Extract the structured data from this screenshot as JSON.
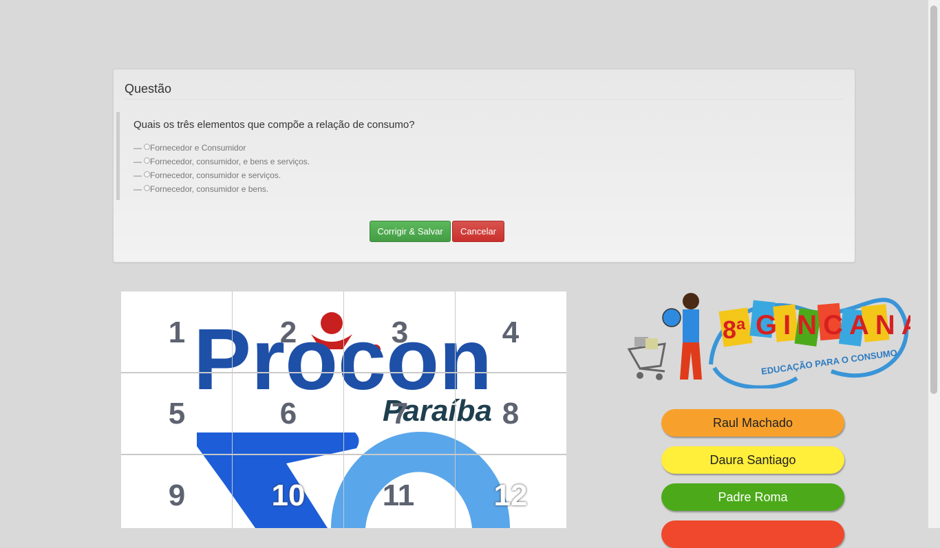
{
  "panel": {
    "title": "Questão",
    "question": "Quais os três elementos que compõe a relação de consumo?",
    "option_dash": "—",
    "options": [
      "Fornecedor e Consumidor",
      "Fornecedor, consumidor, e bens e serviços.",
      "Fornecedor, consumidor e serviços.",
      "Fornecedor, consumidor e bens."
    ],
    "save_label": "Corrigir & Salvar",
    "cancel_label": "Cancelar"
  },
  "puzzle": {
    "logo_text": "Procon",
    "logo_sub": "Paraíba",
    "numbers": [
      "1",
      "2",
      "3",
      "4",
      "5",
      "6",
      "7",
      "8",
      "9",
      "10",
      "11",
      "12"
    ]
  },
  "gincana": {
    "number": "8ª",
    "word": "GINCANA",
    "subtitle": "EDUCAÇÃO PARA O CONSUMO"
  },
  "teams": [
    {
      "name": "Raul Machado",
      "color": "#f7a12c",
      "text": "#222"
    },
    {
      "name": "Daura Santiago",
      "color": "#ffee3a",
      "text": "#222"
    },
    {
      "name": "Padre Roma",
      "color": "#4caa1a",
      "text": "#fff"
    },
    {
      "name": "",
      "color": "#f0482c",
      "text": "#fff"
    }
  ]
}
